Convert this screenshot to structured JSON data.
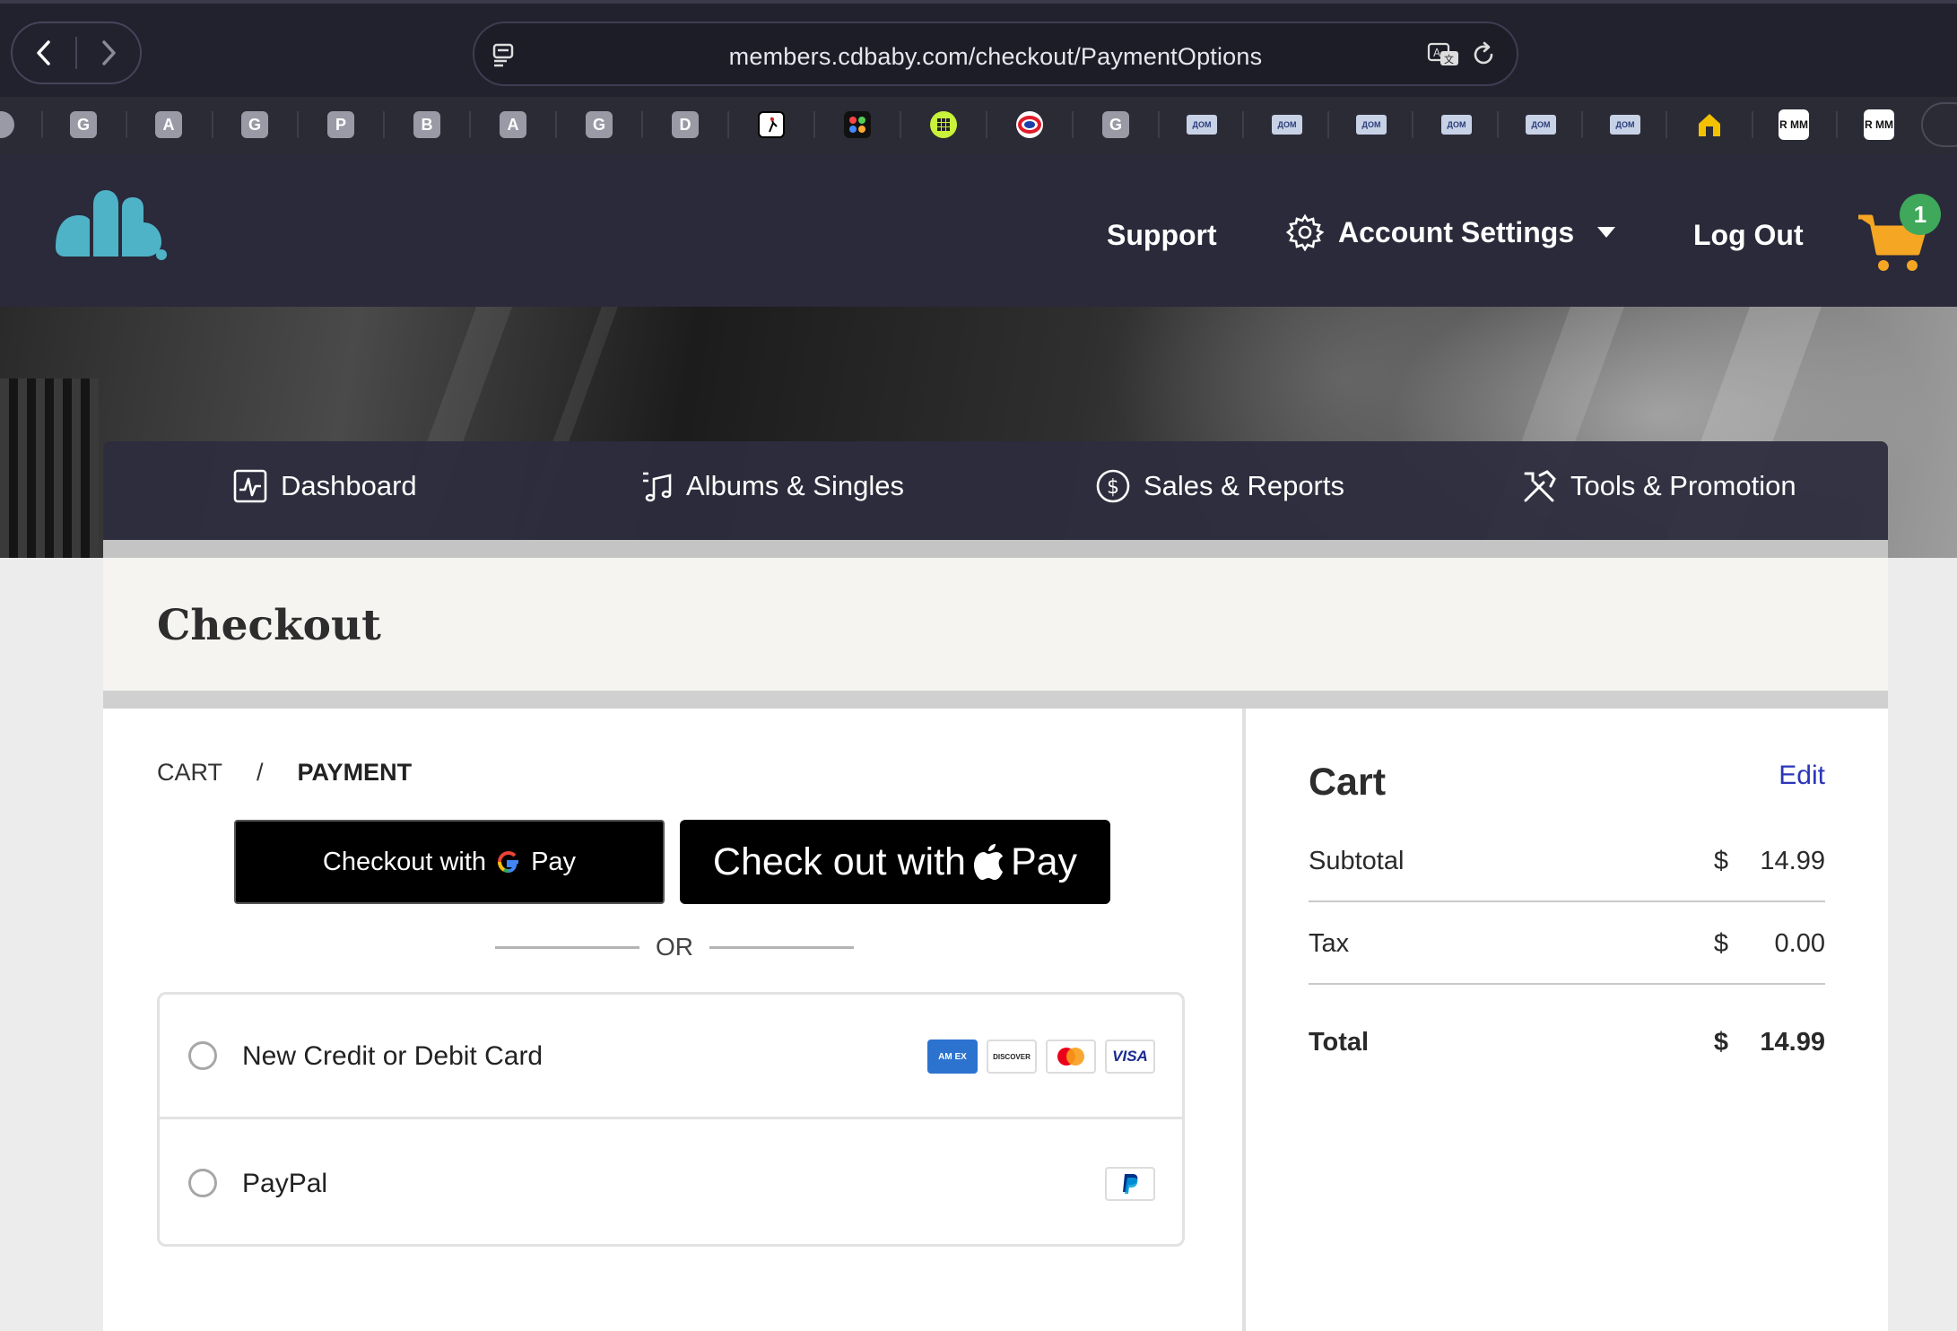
{
  "browser": {
    "url": "members.cdbaby.com/checkout/PaymentOptions",
    "bookmarks": [
      "G",
      "A",
      "G",
      "P",
      "B",
      "A",
      "G",
      "D"
    ],
    "bookmark_dom_label": "ДОМ",
    "bookmark_rmm_label": "R MM"
  },
  "header": {
    "support": "Support",
    "account_settings": "Account Settings",
    "logout": "Log Out",
    "cart_count": "1"
  },
  "tabs": {
    "dashboard": "Dashboard",
    "albums": "Albums & Singles",
    "sales": "Sales & Reports",
    "tools": "Tools & Promotion"
  },
  "page": {
    "title": "Checkout"
  },
  "checkout": {
    "breadcrumb_cart": "CART",
    "breadcrumb_sep": "/",
    "breadcrumb_payment": "PAYMENT",
    "gpay_label": "Checkout with",
    "gpay_pay": "Pay",
    "apay_label": "Check out with",
    "apay_pay": "Pay",
    "or": "OR",
    "option_card": "New Credit or Debit Card",
    "option_paypal": "PayPal",
    "card_brands": {
      "amex": "AM EX",
      "discover": "DISCOVER",
      "visa": "VISA"
    }
  },
  "cart": {
    "title": "Cart",
    "edit": "Edit",
    "subtotal_label": "Subtotal",
    "subtotal_currency": "$",
    "subtotal_value": "14.99",
    "tax_label": "Tax",
    "tax_currency": "$",
    "tax_value": "0.00",
    "total_label": "Total",
    "total_currency": "$",
    "total_value": "14.99"
  },
  "colors": {
    "header_bg": "#2a2a3a",
    "logo": "#4fb3c8",
    "cart_icon": "#f5a623",
    "cart_badge": "#3fa85a",
    "link": "#2a36b8"
  }
}
